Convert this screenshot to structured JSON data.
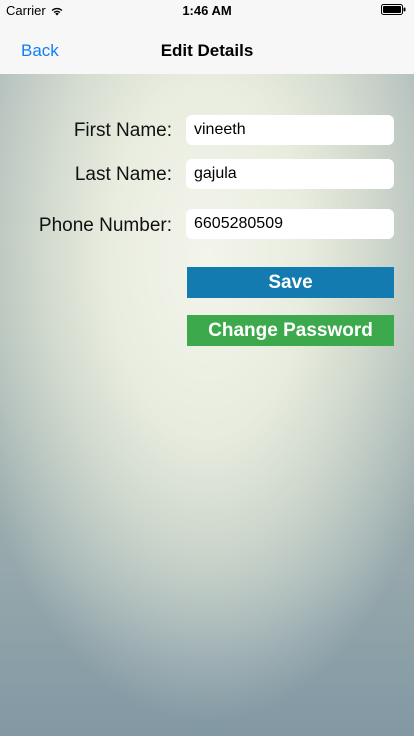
{
  "status_bar": {
    "carrier": "Carrier",
    "time": "1:46 AM"
  },
  "nav": {
    "back_label": "Back",
    "title": "Edit Details"
  },
  "form": {
    "first_name_label": "First Name:",
    "first_name_value": "vineeth",
    "last_name_label": "Last Name:",
    "last_name_value": "gajula",
    "phone_label": "Phone Number:",
    "phone_value": "6605280509"
  },
  "buttons": {
    "save_label": "Save",
    "change_password_label": "Change Password"
  },
  "colors": {
    "link_blue": "#0f7ff5",
    "save_button": "#137bb0",
    "change_password_button": "#3caa4c"
  },
  "icons": {
    "wifi": "wifi-icon",
    "battery": "battery-icon"
  }
}
